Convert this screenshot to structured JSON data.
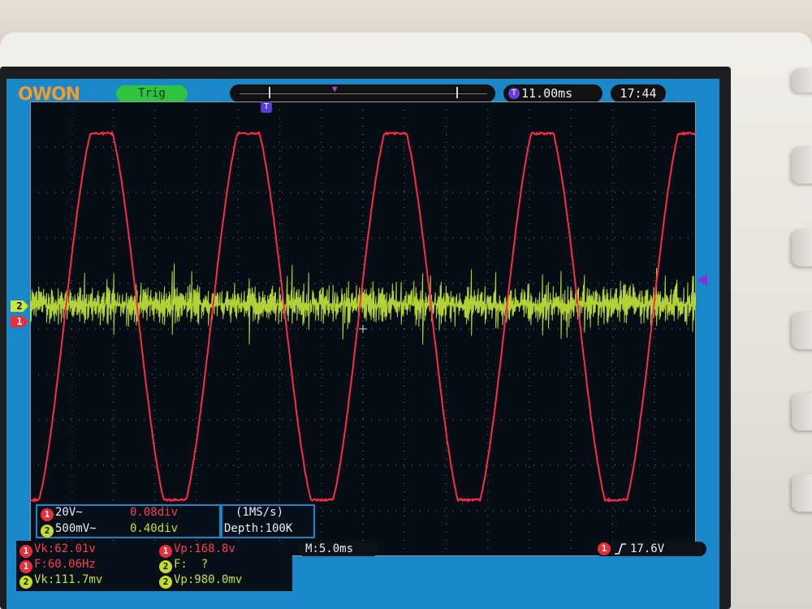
{
  "brand": "OWON",
  "trigger_status": "Trig",
  "horizontal_position": "11.00ms",
  "clock": "17:44",
  "channel_labels": {
    "ch1": "1",
    "ch2": "2"
  },
  "ch1_settings": {
    "scale": "20V~",
    "offset": "0.08div"
  },
  "ch2_settings": {
    "scale": "500mV~",
    "offset": "0.40div"
  },
  "acquisition": {
    "sample_rate": "(1MS/s)",
    "depth": "Depth:100K"
  },
  "timebase": "M:5.0ms",
  "trigger_info": {
    "level": "17.6V"
  },
  "measurements": {
    "ch1_vk": "Vk:62.01v",
    "ch1_vp": "Vp:168.8v",
    "ch1_f": "F:60.06Hz",
    "ch2_f": "F:  ?",
    "ch2_vk": "Vk:111.7mv",
    "ch2_vp": "Vp:980.0mv"
  },
  "colors": {
    "ch1": "#ff2a4a",
    "ch2": "#c7e83a",
    "screen_border": "#1a87c8",
    "plot_bg": "#070d14",
    "grid": "#d0d6dc",
    "trigger_badge": "#2ec440",
    "brand": "#f19a2e"
  },
  "icons": {
    "trigger_marker": "T-marker-icon",
    "trigger_edge": "rising-edge-icon"
  }
}
